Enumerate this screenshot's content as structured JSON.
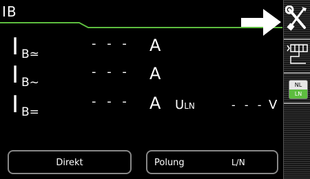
{
  "header": {
    "title": "IB"
  },
  "readings": [
    {
      "symbol": "I",
      "subscript": "B≃",
      "value": "- - -",
      "unit": "A"
    },
    {
      "symbol": "I",
      "subscript": "B~",
      "value": "- - -",
      "unit": "A"
    },
    {
      "symbol": "I",
      "subscript": "B=",
      "value": "- - -",
      "unit": "A"
    }
  ],
  "voltage": {
    "label": "U",
    "label_sub": "LN",
    "value": "- - -",
    "unit": "V"
  },
  "buttons": {
    "direkt": "Direkt",
    "polung_label": "Polung",
    "polung_value": "L/N"
  },
  "sidebar": {
    "tools_icon": "wrench-screwdriver-icon",
    "measure_icon": "measurement-setup-icon",
    "nl_label": "NL",
    "ln_label": "LN"
  },
  "colors": {
    "accent_green": "#5dbd3f",
    "background": "#000000",
    "border_gray": "#888888"
  }
}
